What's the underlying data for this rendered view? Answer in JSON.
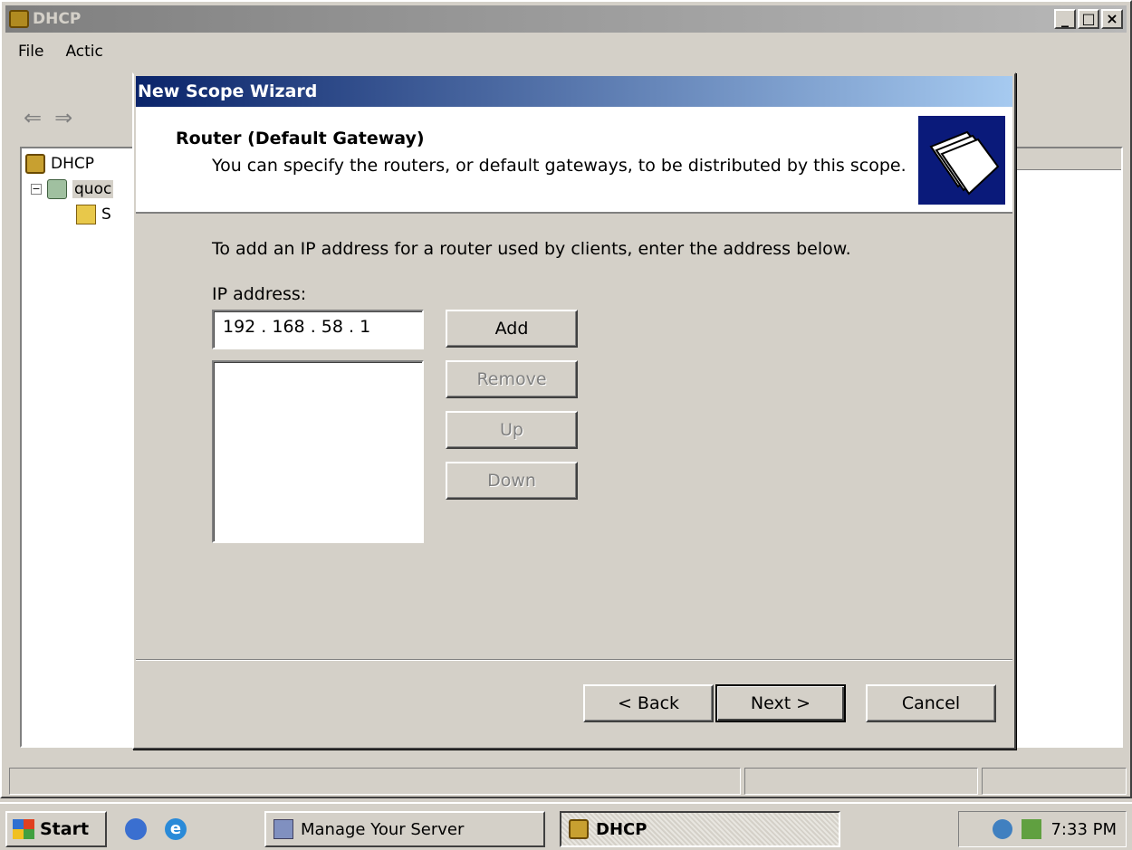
{
  "main_window": {
    "title": "DHCP",
    "menu": [
      "File",
      "Actic"
    ],
    "tree": {
      "root": "DHCP",
      "server": "quoc",
      "child": "S"
    }
  },
  "dialog": {
    "title": "New Scope Wizard",
    "header_title": "Router (Default Gateway)",
    "header_subtitle": "You can specify the routers, or default gateways, to be distributed by this scope.",
    "instruction": "To add an IP address for a router used by clients, enter the address below.",
    "ip_label": "IP address:",
    "ip_value": "192 . 168 .  58  .  1",
    "buttons": {
      "add": "Add",
      "remove": "Remove",
      "up": "Up",
      "down": "Down"
    },
    "nav": {
      "back": "< Back",
      "next": "Next >",
      "cancel": "Cancel"
    }
  },
  "taskbar": {
    "start": "Start",
    "tasks": [
      "Manage Your Server",
      "DHCP"
    ],
    "clock": "7:33 PM"
  }
}
